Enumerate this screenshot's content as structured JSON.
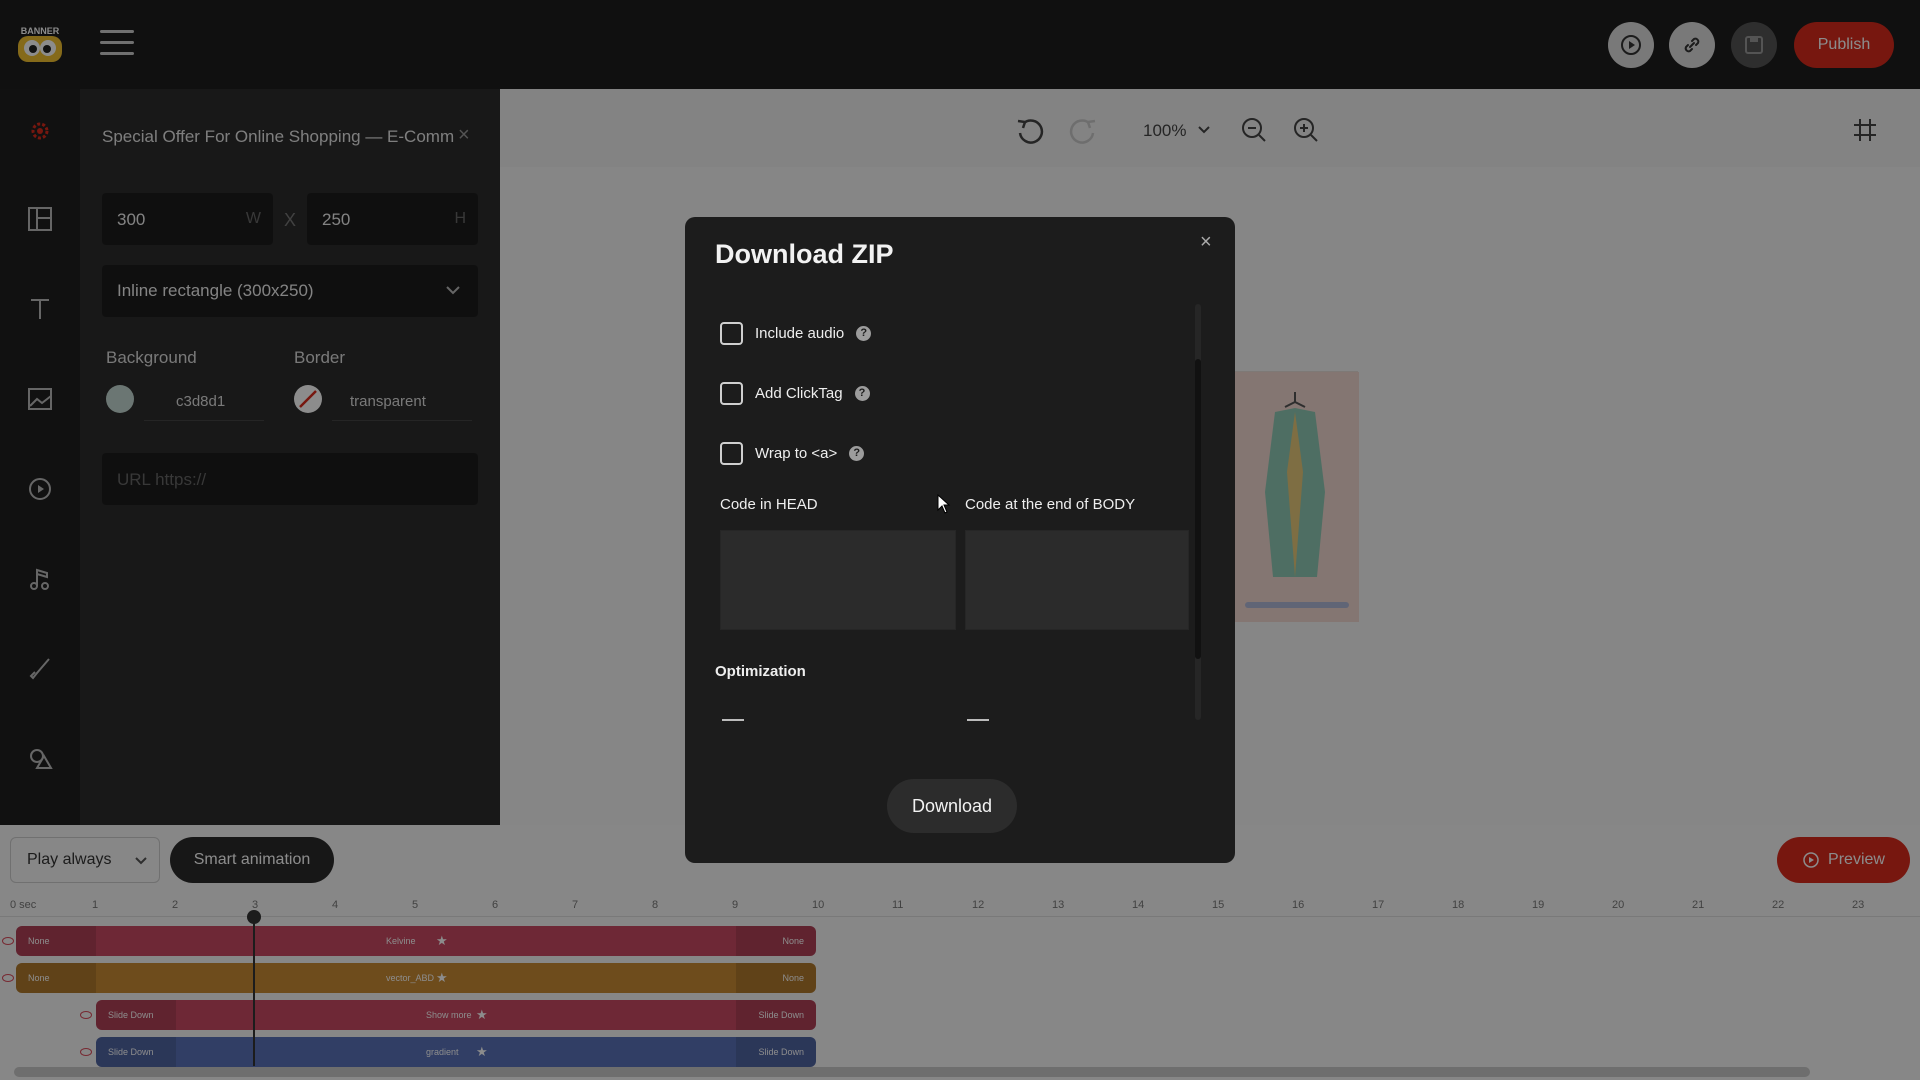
{
  "topbar": {
    "logo_text": "BANNER BOO",
    "publish_label": "Publish"
  },
  "panel": {
    "project_title": "Special Offer For Online Shopping — E-Comm",
    "width_value": "300",
    "width_unit": "W",
    "separator": "X",
    "height_value": "250",
    "height_unit": "H",
    "size_preset": "Inline rectangle (300x250)",
    "background_label": "Background",
    "background_value": "c3d8d1",
    "background_color": "#c3d8d1",
    "border_label": "Border",
    "border_value": "transparent",
    "url_placeholder": "URL https://"
  },
  "canvas": {
    "zoom": "100%"
  },
  "timeline": {
    "play_mode": "Play always",
    "smart_animation": "Smart animation",
    "preview_label": "Preview",
    "ticks": [
      "0 sec",
      "1",
      "2",
      "3",
      "4",
      "5",
      "6",
      "7",
      "8",
      "9",
      "10",
      "11",
      "12",
      "13",
      "14",
      "15",
      "16",
      "17",
      "18",
      "19",
      "20",
      "21",
      "22",
      "23"
    ],
    "tracks": [
      {
        "start": "None",
        "name": "Kelvine",
        "end": "None",
        "color": "#c94a63"
      },
      {
        "start": "None",
        "name": "vector_ABD",
        "end": "None",
        "color": "#c88a34"
      },
      {
        "start": "Slide Down",
        "name": "Show more",
        "end": "Slide Down",
        "color": "#c94a63"
      },
      {
        "start": "Slide Down",
        "name": "gradient",
        "end": "Slide Down",
        "color": "#5a72b8"
      }
    ]
  },
  "modal": {
    "title": "Download ZIP",
    "close": "×",
    "include_audio": "Include audio",
    "add_clicktag": "Add ClickTag",
    "wrap_to_a": "Wrap to <a>",
    "help": "?",
    "code_in_head": "Code in HEAD",
    "code_end_body": "Code at the end of BODY",
    "optimization": "Optimization",
    "download_label": "Download"
  },
  "colors": {
    "accent": "#d92a1c",
    "modal_bg": "#1c1c1c",
    "panel_bg": "#2c2c2c"
  }
}
